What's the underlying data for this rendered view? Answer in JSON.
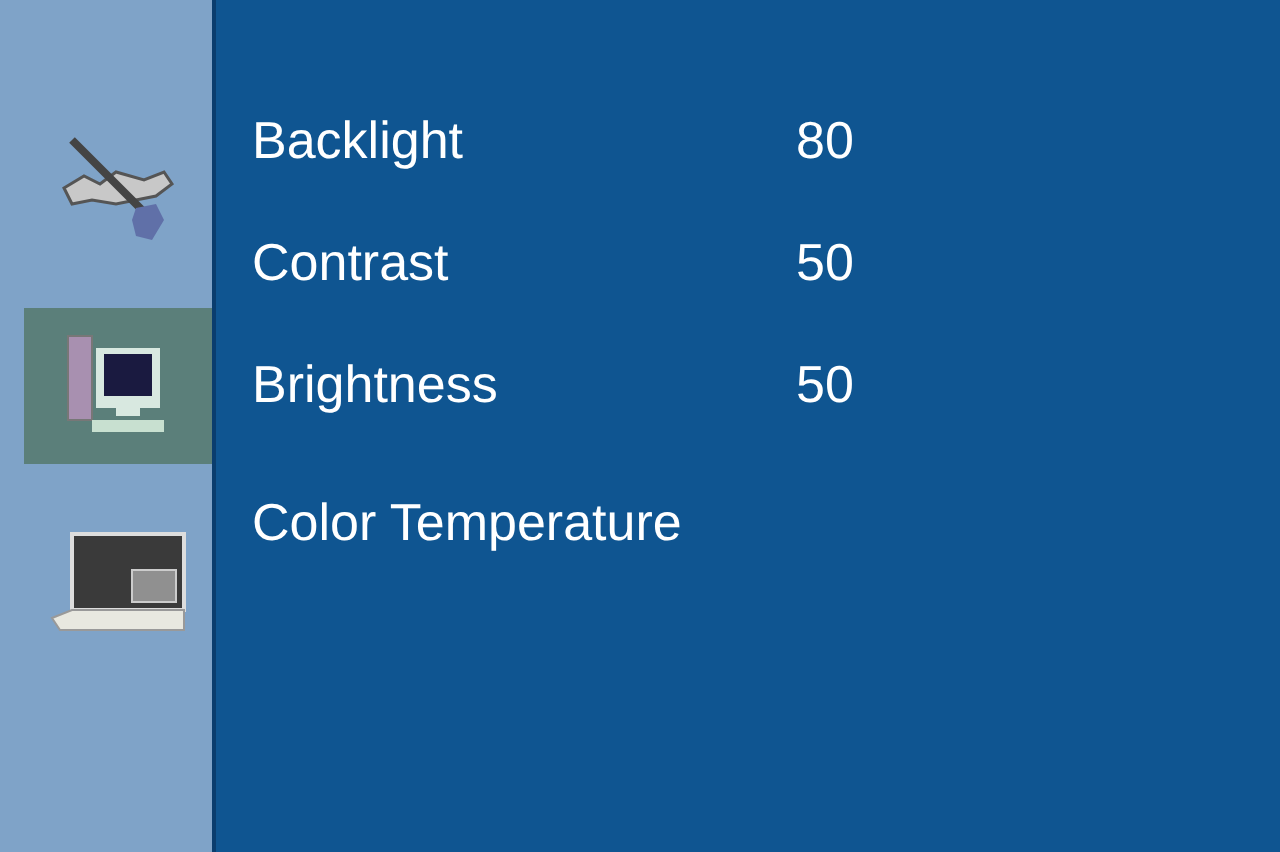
{
  "sidebar": {
    "items": [
      {
        "kind": "tools",
        "selected": false
      },
      {
        "kind": "computer",
        "selected": true
      },
      {
        "kind": "laptop",
        "selected": false
      }
    ]
  },
  "settings": [
    {
      "label": "Backlight",
      "value": "80"
    },
    {
      "label": "Contrast",
      "value": "50"
    },
    {
      "label": "Brightness",
      "value": "50"
    },
    {
      "label": "Color Temperature"
    }
  ]
}
